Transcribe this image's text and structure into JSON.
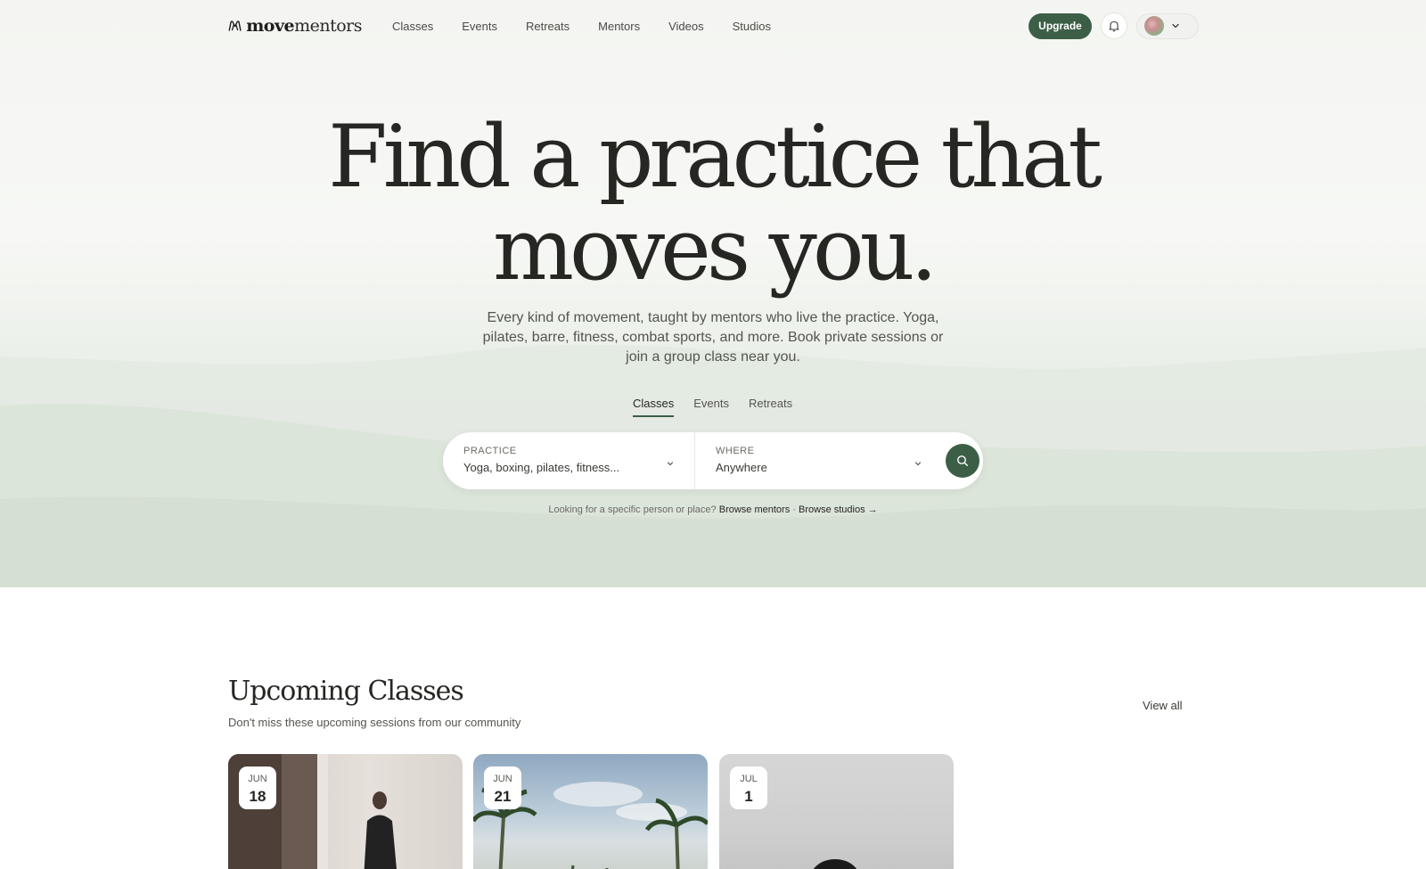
{
  "brand": {
    "name_bold": "move",
    "name_light": "mentors"
  },
  "nav": {
    "links": [
      "Classes",
      "Events",
      "Retreats",
      "Mentors",
      "Videos",
      "Studios"
    ],
    "upgrade_label": "Upgrade"
  },
  "hero": {
    "headline_line1": "Find a practice that",
    "headline_line2": "moves you.",
    "subtitle": "Every kind of movement, taught by mentors who live the practice. Yoga, pilates, barre, fitness, combat sports, and more. Book private sessions or join a group class near you."
  },
  "tabs": [
    {
      "label": "Classes",
      "active": true
    },
    {
      "label": "Events",
      "active": false
    },
    {
      "label": "Retreats",
      "active": false
    }
  ],
  "search": {
    "practice_label": "PRACTICE",
    "practice_value": "Yoga, boxing, pilates, fitness...",
    "where_label": "WHERE",
    "where_value": "Anywhere"
  },
  "browse": {
    "prompt": "Looking for a specific person or place?",
    "mentors_link": "Browse mentors",
    "separator": "·",
    "studios_link": "Browse studios →"
  },
  "upcoming": {
    "title": "Upcoming Classes",
    "subtitle": "Don't miss these upcoming sessions from our community",
    "view_all": "View all",
    "cards": [
      {
        "month": "JUN",
        "day": "18"
      },
      {
        "month": "JUN",
        "day": "21"
      },
      {
        "month": "JUL",
        "day": "1"
      }
    ]
  },
  "colors": {
    "accent": "#3c5e47",
    "text": "#262623",
    "hero_bg": "#f4f5f2"
  }
}
